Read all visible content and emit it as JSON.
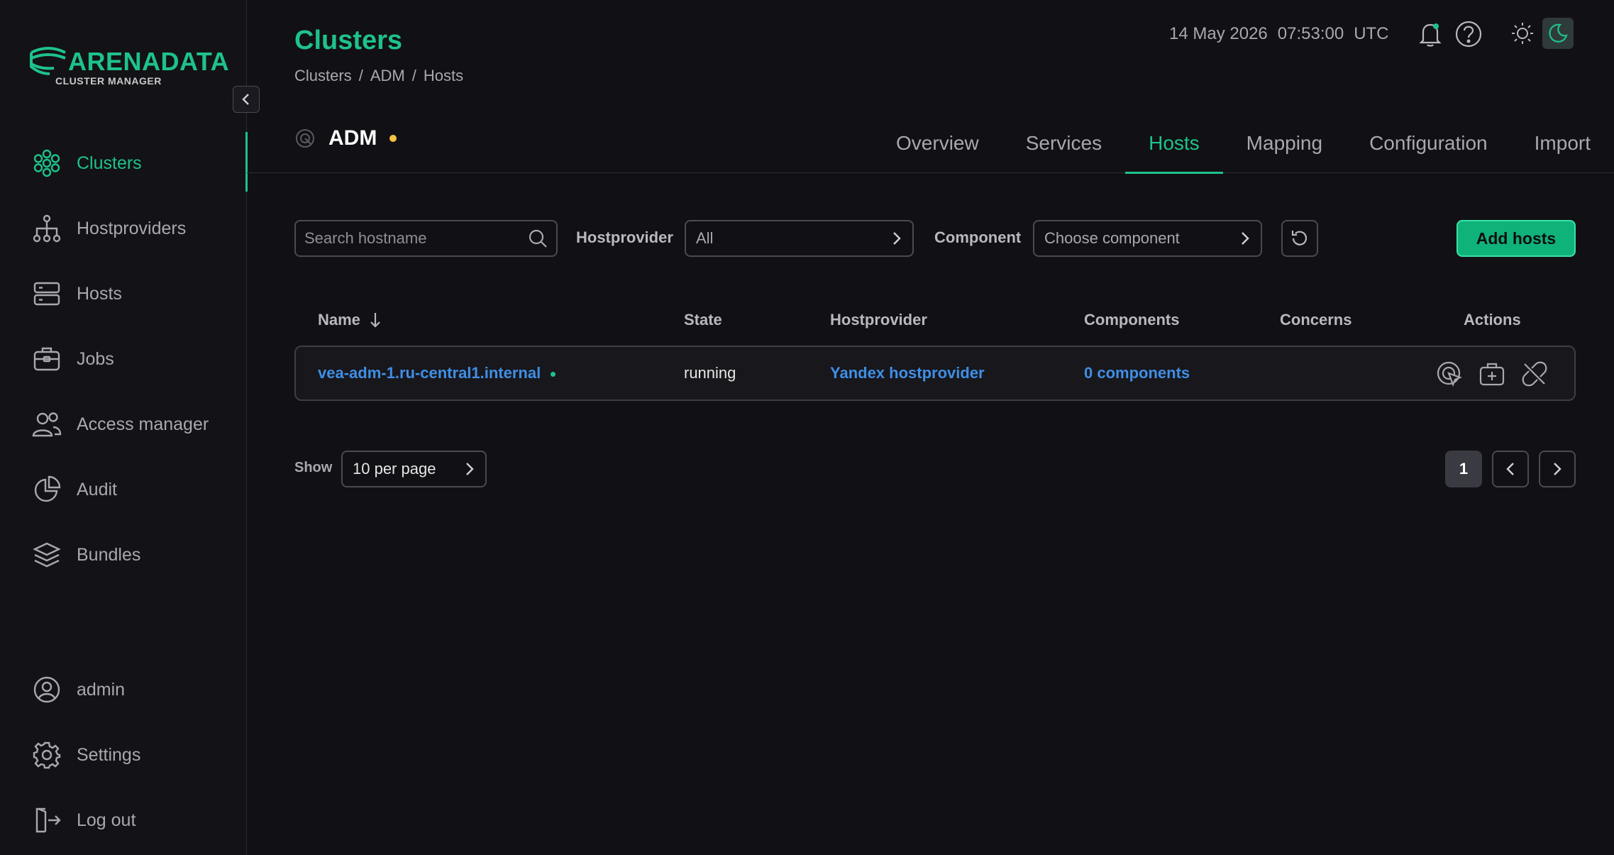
{
  "app": {
    "logo_title": "ARENADATA",
    "logo_subtitle": "CLUSTER MANAGER",
    "accent_color": "#1ec28b",
    "link_color": "#3f8fe6"
  },
  "sidebar": {
    "items": [
      {
        "label": "Clusters",
        "icon": "clusters-icon",
        "active": true
      },
      {
        "label": "Hostproviders",
        "icon": "hostproviders-icon"
      },
      {
        "label": "Hosts",
        "icon": "hosts-icon"
      },
      {
        "label": "Jobs",
        "icon": "jobs-icon"
      },
      {
        "label": "Access manager",
        "icon": "access-manager-icon"
      },
      {
        "label": "Audit",
        "icon": "audit-icon"
      },
      {
        "label": "Bundles",
        "icon": "bundles-icon"
      }
    ],
    "bottom_items": [
      {
        "label": "admin",
        "icon": "user-icon"
      },
      {
        "label": "Settings",
        "icon": "gear-icon"
      },
      {
        "label": "Log out",
        "icon": "logout-icon"
      }
    ]
  },
  "header": {
    "title": "Clusters",
    "breadcrumb": [
      "Clusters",
      "/",
      "ADM",
      "/",
      "Hosts"
    ],
    "date": "14 May 2026",
    "time": "07:53:00",
    "timezone": "UTC"
  },
  "cluster": {
    "name": "ADM",
    "tabs": [
      "Overview",
      "Services",
      "Hosts",
      "Mapping",
      "Configuration",
      "Import"
    ],
    "active_tab": "Hosts"
  },
  "filters": {
    "search_placeholder": "Search hostname",
    "hostprovider_label": "Hostprovider",
    "hostprovider_value": "All",
    "component_label": "Component",
    "component_placeholder": "Choose component",
    "add_button": "Add hosts"
  },
  "table": {
    "columns": [
      "Name",
      "State",
      "Hostprovider",
      "Components",
      "Concerns",
      "Actions"
    ],
    "rows": [
      {
        "name": "vea-adm-1.ru-central1.internal",
        "state": "running",
        "hostprovider": "Yandex hostprovider",
        "components": "0 components",
        "concerns": ""
      }
    ]
  },
  "pagination": {
    "show_label": "Show",
    "per_page": "10 per page",
    "current_page": "1"
  }
}
